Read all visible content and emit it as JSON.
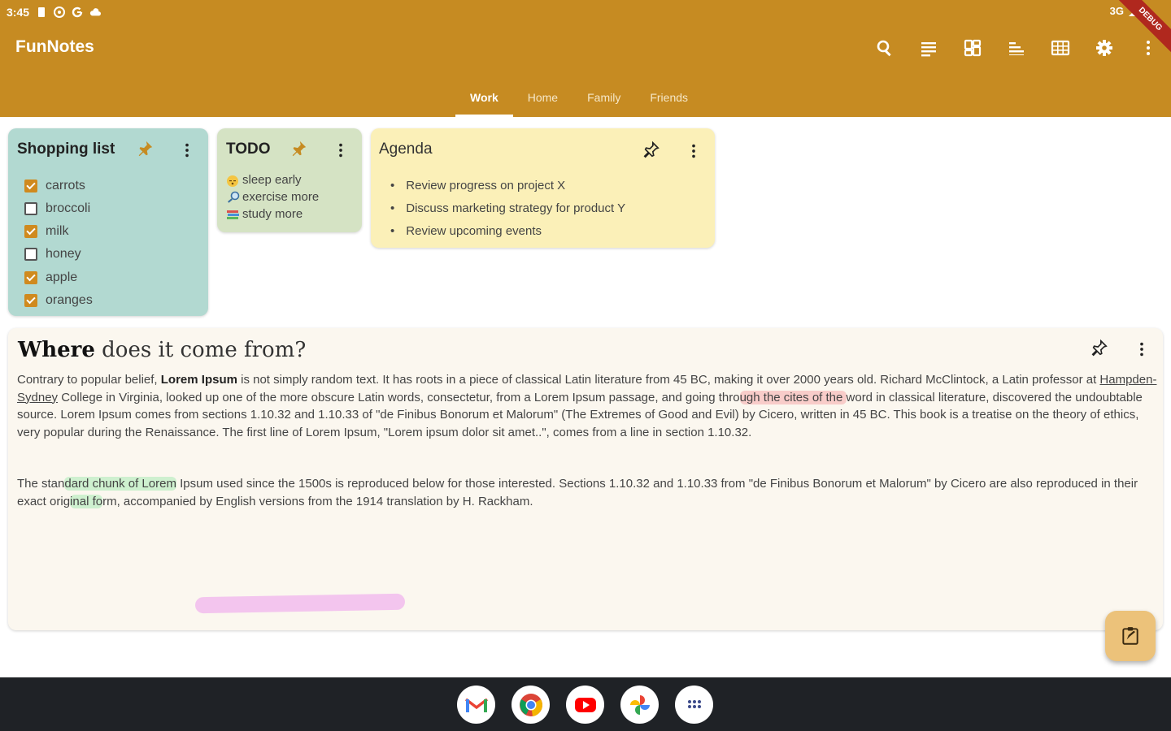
{
  "status_bar": {
    "time": "3:45",
    "network": "3G"
  },
  "debug_banner": "DEBUG",
  "app": {
    "title": "FunNotes"
  },
  "toolbar_icons": [
    "search-icon",
    "list-view-icon",
    "grid-view-icon",
    "align-left-icon",
    "calendar-icon",
    "settings-icon",
    "more-vert-icon"
  ],
  "tabs": [
    {
      "label": "Work",
      "active": true
    },
    {
      "label": "Home",
      "active": false
    },
    {
      "label": "Family",
      "active": false
    },
    {
      "label": "Friends",
      "active": false
    }
  ],
  "notes": {
    "shopping": {
      "title": "Shopping list",
      "color": "#b2d9d1",
      "items": [
        {
          "label": "carrots",
          "checked": true
        },
        {
          "label": "broccoli",
          "checked": false
        },
        {
          "label": "milk",
          "checked": true
        },
        {
          "label": "honey",
          "checked": false
        },
        {
          "label": "apple",
          "checked": true
        },
        {
          "label": "oranges",
          "checked": true
        }
      ]
    },
    "todo": {
      "title": "TODO",
      "color": "#d5e3c4",
      "items": [
        {
          "emoji": "sleeping-face-icon",
          "label": "sleep early"
        },
        {
          "emoji": "magnifier-icon",
          "label": "exercise more"
        },
        {
          "emoji": "books-icon",
          "label": "study more"
        }
      ]
    },
    "agenda": {
      "title": "Agenda",
      "color": "#fbf0b8",
      "items": [
        "Review progress on project X",
        "Discuss marketing strategy for product Y",
        "Review upcoming events"
      ]
    },
    "article": {
      "title_bold": "Where",
      "title_rest": " does it come from?",
      "p1": {
        "a": "Contrary to popular belief, ",
        "b": "Lorem Ipsum",
        "c": " is not simply random text. It has roots in a piece of classical Latin literature from 45 BC, making it over 2000 years old. Richard McClintock, a Latin professor at ",
        "d": "Hampden-Sydney",
        "e": " College in Virginia, looked up one of the more obscure Latin words, consectetur, from a Lorem Ipsum passage, and going thro",
        "f": "ugh the cites of the ",
        "g": "word in classical literature, discovered the undoubtable source. Lorem Ipsum comes from sections 1.10.32 and 1.10.33 of \"de Finibus Bonorum et Malorum\" (The Extremes of Good and Evil) by Cicero, written in 45 BC. This book is a treatise on the theory of ethics, very popular during the Renaissance. The first line of Lorem Ipsum, \"Lorem ipsum dolor sit amet..\", comes from a line in section 1.10.32."
      },
      "p2": {
        "a": "The stan",
        "b": "dard chunk of Lorem",
        "c": " Ipsum used since the 1500s is reproduced below for those interested. Sections 1.10.32 and 1.10.33 from \"de Finibus Bonorum et Malorum\" by Cicero are also reproduced in their exact orig",
        "d": "inal fo",
        "e": "rm, accompanied by English versions from the 1914 translation by H. Rackham."
      }
    }
  },
  "colors": {
    "appbar": "#c68b22",
    "fab": "#ecc27a",
    "accent": "#d08a1e"
  },
  "dock_apps": [
    "gmail-icon",
    "chrome-icon",
    "youtube-icon",
    "photos-icon",
    "app-drawer-icon"
  ]
}
